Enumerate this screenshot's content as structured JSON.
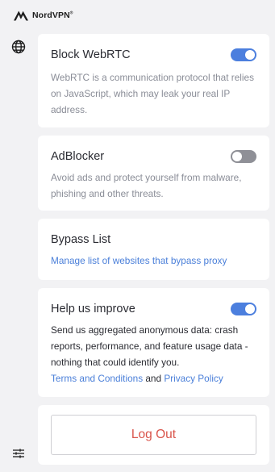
{
  "header": {
    "brand_name": "NordVPN",
    "brand_mark": "®"
  },
  "sidebar": {
    "items": [
      {
        "icon": "globe-icon"
      },
      {
        "icon": "settings-sliders-icon"
      }
    ]
  },
  "settings": {
    "webrtc": {
      "title": "Block WebRTC",
      "description": "WebRTC is a communication protocol that relies on JavaScript, which may leak your real IP address.",
      "enabled": true
    },
    "adblocker": {
      "title": "AdBlocker",
      "description": "Avoid ads and protect yourself from malware, phishing and other threats.",
      "enabled": false
    },
    "bypass": {
      "title": "Bypass List",
      "link": "Manage list of websites that bypass proxy"
    },
    "improve": {
      "title": "Help us improve",
      "description": "Send us aggregated anonymous data: crash reports, performance, and feature usage data - nothing that could identify you.",
      "terms_link": "Terms and Conditions",
      "and_text": "and",
      "privacy_link": "Privacy Policy",
      "enabled": true
    }
  },
  "logout": {
    "label": "Log Out"
  },
  "colors": {
    "accent": "#4c7fde",
    "link": "#4a7fd9",
    "logout": "#d9534a",
    "toggle_off": "#8f9097",
    "background": "#f2f2f4"
  }
}
